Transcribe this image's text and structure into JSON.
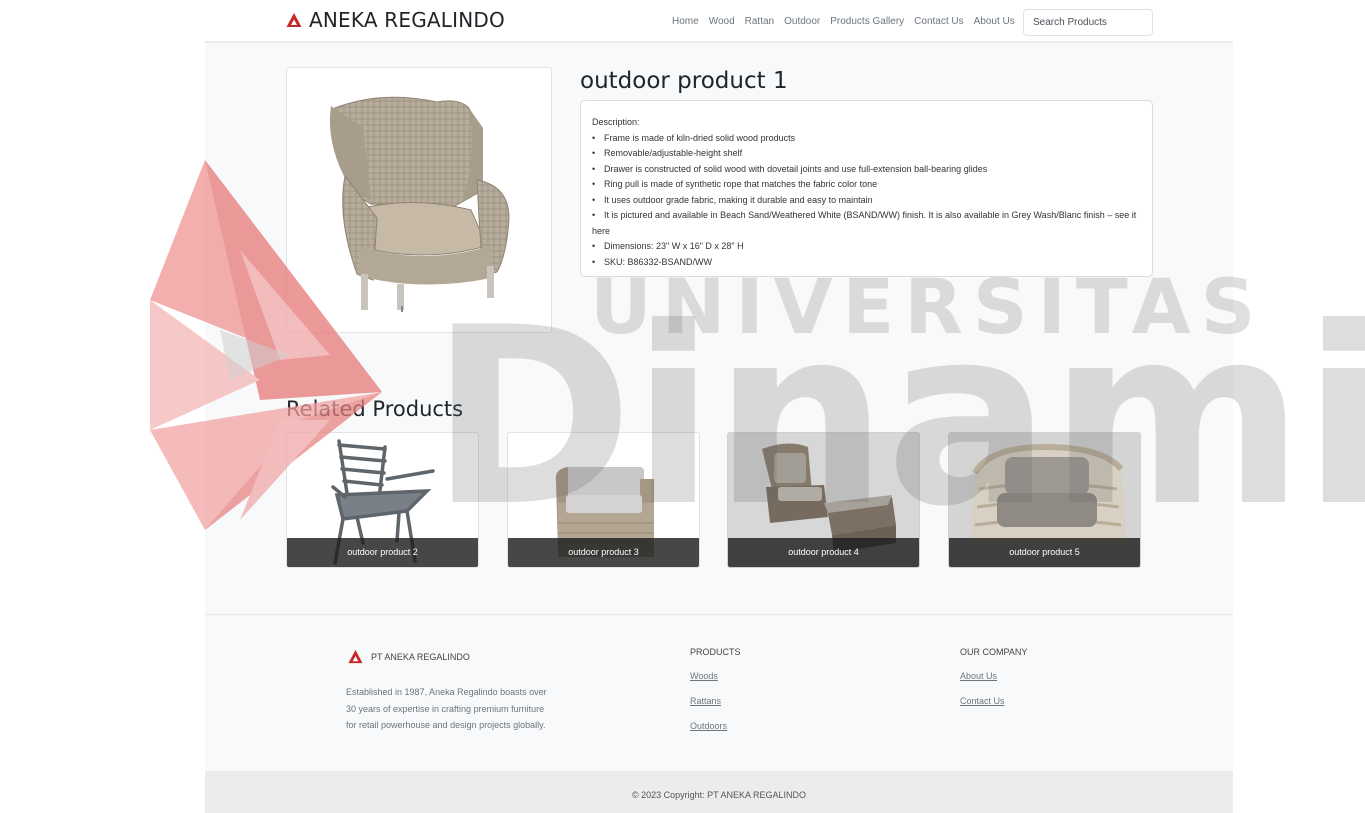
{
  "brand": {
    "name": "ANEKA REGALINDO",
    "icon": "triangle-logo-icon",
    "color": "#c62828"
  },
  "nav": {
    "items": [
      "Home",
      "Wood",
      "Rattan",
      "Outdoor",
      "Products Gallery",
      "Contact Us",
      "About Us"
    ],
    "search_placeholder": "Search Products"
  },
  "product": {
    "title": "outdoor product 1",
    "description_heading": "Description:",
    "bullets": [
      "Frame is made of kiln-dried solid wood products",
      "Removable/adjustable-height shelf",
      "Drawer is constructed of solid wood with dovetail joints and use full-extension ball-bearing glides",
      "Ring pull is made of synthetic rope that matches the fabric color tone",
      "It uses outdoor grade fabric, making it durable and easy to maintain",
      "It is pictured and available in Beach Sand/Weathered White (BSAND/WW) finish. It is also available in Grey Wash/Blanc finish – see it here",
      "Dimensions: 23\" W x 16\" D x 28\" H",
      "SKU: B86332-BSAND/WW"
    ]
  },
  "related": {
    "title": "Related Products",
    "items": [
      {
        "label": "outdoor product 2"
      },
      {
        "label": "outdoor product 3"
      },
      {
        "label": "outdoor product 4"
      },
      {
        "label": "outdoor product 5"
      }
    ]
  },
  "footer": {
    "company_name": "PT ANEKA REGALINDO",
    "about": "Established in 1987, Aneka Regalindo boasts over 30 years of expertise in crafting premium furniture for retail powerhouse and design projects globally.",
    "products_heading": "PRODUCTS",
    "products_links": [
      "Woods",
      "Rattans",
      "Outdoors"
    ],
    "company_heading": "OUR COMPANY",
    "company_links": [
      "About Us",
      "Contact Us"
    ],
    "copyright": "© 2023 Copyright: PT ANEKA REGALINDO"
  },
  "watermark": {
    "line1": "UNIVERSITAS",
    "line2": "Dinamika",
    "color": "#e53935"
  }
}
